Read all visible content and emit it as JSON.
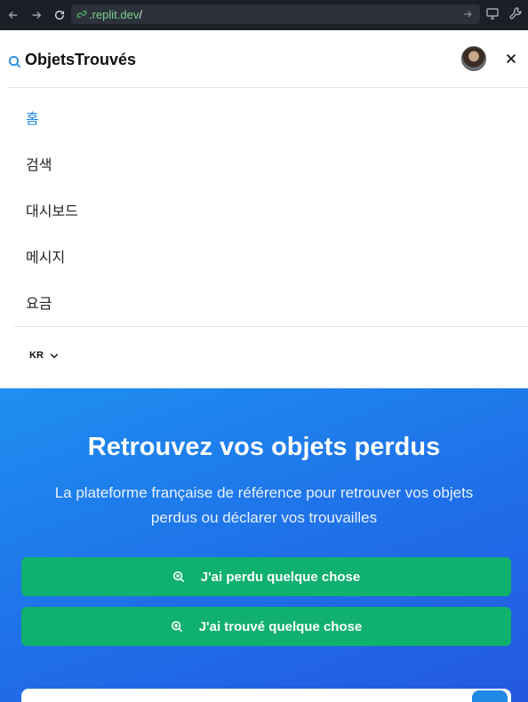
{
  "browser": {
    "url_host": ".replit.dev",
    "url_path": "/"
  },
  "header": {
    "brand": "ObjetsTrouvés"
  },
  "menu": {
    "items": [
      {
        "label": "홈",
        "active": true
      },
      {
        "label": "검색",
        "active": false
      },
      {
        "label": "대시보드",
        "active": false
      },
      {
        "label": "메시지",
        "active": false
      },
      {
        "label": "요금",
        "active": false
      }
    ],
    "language": "KR"
  },
  "hero": {
    "title": "Retrouvez vos objets perdus",
    "subtitle": "La plateforme française de référence pour retrouver vos objets perdus ou déclarer vos trouvailles",
    "lost_button": "J'ai perdu quelque chose",
    "found_button": "J'ai trouvé quelque chose"
  },
  "colors": {
    "accent": "#1e88e5",
    "cta": "#10b06f",
    "hero_start": "#1e8ff0",
    "hero_end": "#2458e0"
  }
}
